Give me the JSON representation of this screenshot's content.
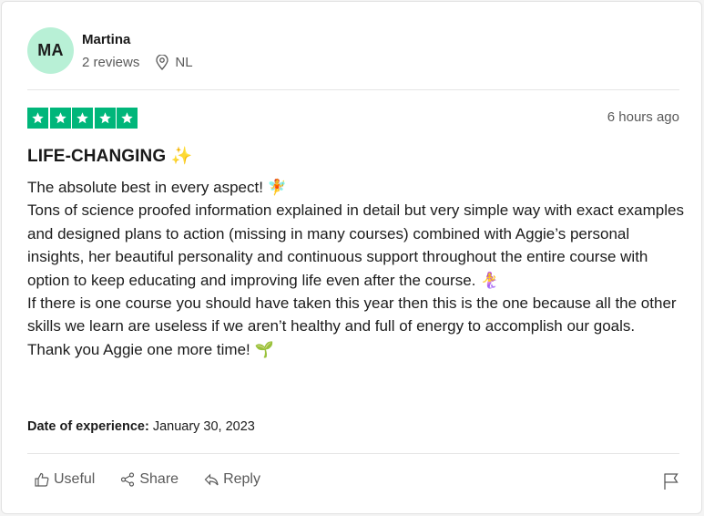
{
  "user": {
    "initials": "MA",
    "name": "Martina",
    "reviews": "2 reviews",
    "country": "NL"
  },
  "review": {
    "rating": 5,
    "time": "6 hours ago",
    "title": "LIFE-CHANGING",
    "title_emoji": "✨",
    "paragraphs": [
      "The absolute best in every aspect! 🧚",
      "Tons of science proofed information explained in detail but very simple way with exact examples and designed plans to action (missing in many courses) combined with Aggie’s personal insights, her beautiful personality and continuous support throughout the entire course with option to keep educating and improving life even after the course. 🧜‍♀️",
      "If there is one course you should have taken this year then this is the one because all the other skills we learn are useless if we aren’t healthy and full of energy to accomplish our goals.",
      "Thank you Aggie one more time! 🌱"
    ],
    "date_label": "Date of experience:",
    "date_value": "January 30, 2023"
  },
  "actions": {
    "useful": "Useful",
    "share": "Share",
    "reply": "Reply"
  },
  "colors": {
    "star_green": "#00b67a",
    "avatar_bg": "#b8f0d6"
  },
  "icons": {
    "location": "location-pin-icon",
    "thumbs_up": "thumbs-up-icon",
    "share": "share-icon",
    "reply": "reply-icon",
    "flag": "flag-icon"
  }
}
